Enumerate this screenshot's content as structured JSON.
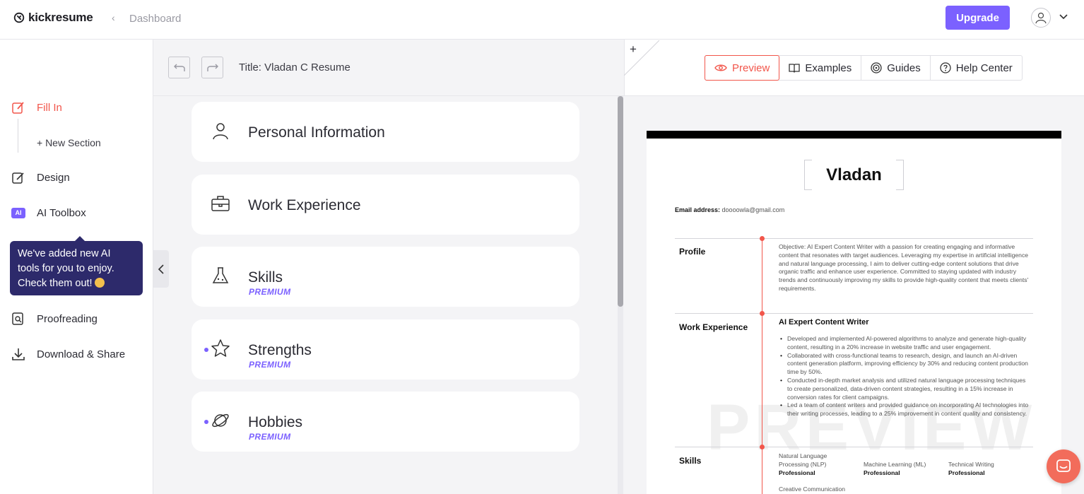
{
  "topbar": {
    "logo": "kickresume",
    "breadcrumb": "Dashboard",
    "upgrade_label": "Upgrade"
  },
  "sidebar": {
    "items": [
      {
        "label": "Fill In"
      },
      {
        "label": "+ New Section"
      },
      {
        "label": "Design"
      },
      {
        "label": "AI Toolbox",
        "badge": "AI"
      },
      {
        "label": "Proofreading"
      },
      {
        "label": "Download & Share"
      }
    ],
    "tooltip": "We've added new AI tools for you to enjoy. Check them out!"
  },
  "editor": {
    "title": "Title: Vladan C Resume",
    "sections": [
      {
        "name": "Personal Information",
        "icon": "person-icon",
        "premium": ""
      },
      {
        "name": "Work Experience",
        "icon": "briefcase-icon",
        "premium": ""
      },
      {
        "name": "Skills",
        "icon": "flask-icon",
        "premium": "PREMIUM"
      },
      {
        "name": "Strengths",
        "icon": "star-icon",
        "premium": "PREMIUM"
      },
      {
        "name": "Hobbies",
        "icon": "planet-icon",
        "premium": "PREMIUM"
      }
    ]
  },
  "preview_tabs": [
    {
      "label": "Preview",
      "icon": "eye-icon"
    },
    {
      "label": "Examples",
      "icon": "book-icon"
    },
    {
      "label": "Guides",
      "icon": "target-icon"
    },
    {
      "label": "Help Center",
      "icon": "question-icon"
    }
  ],
  "resume": {
    "name": "Vladan",
    "email_label": "Email address:",
    "email": "doooowla@gmail.com",
    "profile_title": "Profile",
    "profile_text": "Objective: AI Expert Content Writer with a passion for creating engaging and informative content that resonates with target audiences. Leveraging my expertise in artificial intelligence and natural language processing, I aim to deliver cutting-edge content solutions that drive organic traffic and enhance user experience. Committed to staying updated with industry trends and continuously improving my skills to provide high-quality content that meets clients' requirements.",
    "work_title": "Work Experience",
    "job_title": "AI Expert Content Writer",
    "bullets": [
      "Developed and implemented AI-powered algorithms to analyze and generate high-quality content, resulting in a 20% increase in website traffic and user engagement.",
      "Collaborated with cross-functional teams to research, design, and launch an AI-driven content generation platform, improving efficiency by 30% and reducing content production time by 50%.",
      "Conducted in-depth market analysis and utilized natural language processing techniques to create personalized, data-driven content strategies, resulting in a 15% increase in conversion rates for client campaigns.",
      "Led a team of content writers and provided guidance on incorporating AI technologies into their writing processes, leading to a 25% improvement in content quality and consistency."
    ],
    "skills_title": "Skills",
    "skills": [
      {
        "name": "Natural Language Processing (NLP)",
        "level": "Professional"
      },
      {
        "name": "Machine Learning (ML)",
        "level": "Professional"
      },
      {
        "name": "Technical Writing",
        "level": "Professional"
      },
      {
        "name": "Creative Communication",
        "level": ""
      }
    ],
    "watermark": "PREVIEW"
  },
  "colors": {
    "accent": "#7b61ff",
    "active": "#f2564b",
    "tooltip_bg": "#2d2a6b"
  }
}
